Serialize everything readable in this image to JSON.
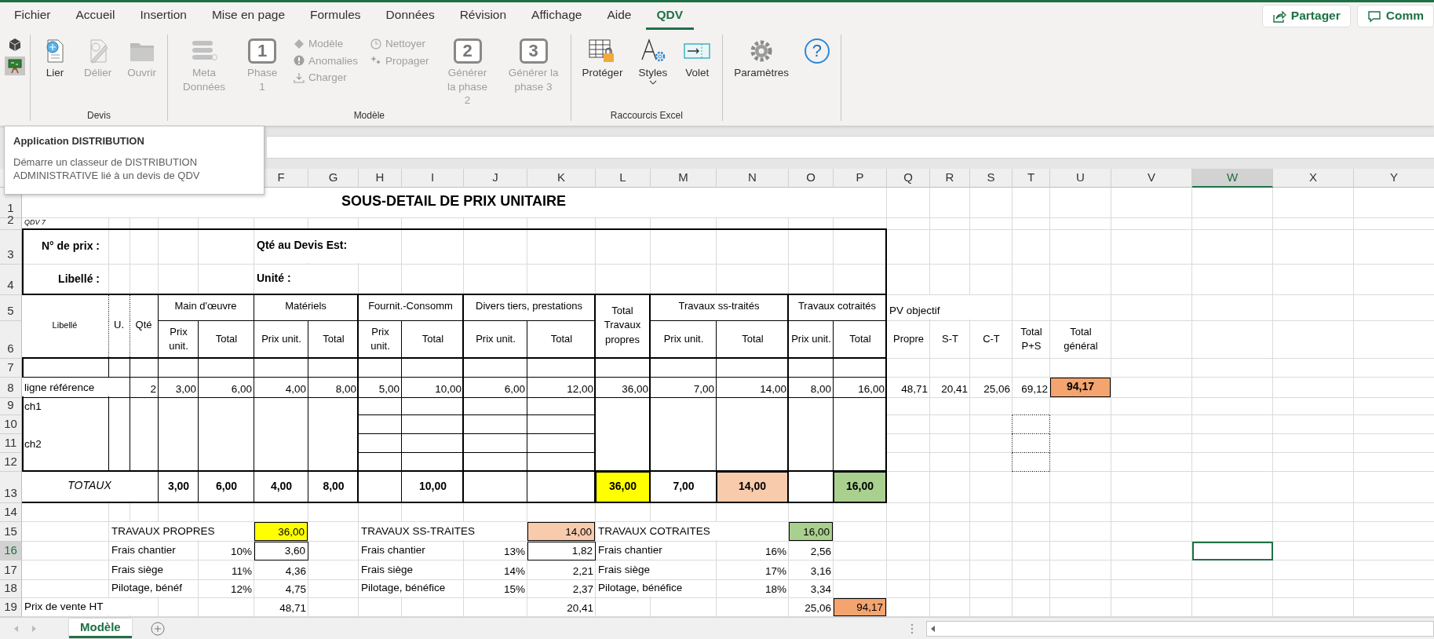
{
  "tabs": [
    {
      "label": "Fichier",
      "selected": false
    },
    {
      "label": "Accueil",
      "selected": false
    },
    {
      "label": "Insertion",
      "selected": false
    },
    {
      "label": "Mise en page",
      "selected": false
    },
    {
      "label": "Formules",
      "selected": false
    },
    {
      "label": "Données",
      "selected": false
    },
    {
      "label": "Révision",
      "selected": false
    },
    {
      "label": "Affichage",
      "selected": false
    },
    {
      "label": "Aide",
      "selected": false
    },
    {
      "label": "QDV",
      "selected": true
    }
  ],
  "header_buttons": [
    {
      "label": "Partager"
    },
    {
      "label": "Comm"
    }
  ],
  "ribbon": {
    "groups": [
      {
        "items": [
          {
            "kind": "tiny",
            "selected": false
          },
          {
            "kind": "tiny",
            "selected": true
          }
        ]
      },
      {
        "label": "Devis",
        "items": [
          {
            "kind": "large",
            "label": "Lier",
            "disabled": false
          },
          {
            "kind": "large",
            "label": "Délier",
            "disabled": true
          },
          {
            "kind": "large",
            "label": "Ouvrir",
            "disabled": true
          }
        ]
      },
      {
        "label": "Modèle",
        "items": [
          {
            "kind": "large",
            "label": "Meta Données",
            "disabled": true
          },
          {
            "kind": "numbered",
            "glyph": "1",
            "label": "Phase 1",
            "disabled": true
          },
          {
            "kind": "small",
            "label": "Modèle",
            "disabled": true
          },
          {
            "kind": "small",
            "label": "Anomalies",
            "disabled": true
          },
          {
            "kind": "small",
            "label": "Charger",
            "disabled": true
          },
          {
            "kind": "small",
            "label": "Nettoyer",
            "disabled": true
          },
          {
            "kind": "small",
            "label": "Propager",
            "disabled": true
          },
          {
            "kind": "numbered",
            "glyph": "2",
            "label": "Générer la phase 2",
            "disabled": true
          },
          {
            "kind": "numbered",
            "glyph": "3",
            "label": "Générer la phase 3",
            "disabled": true
          }
        ]
      },
      {
        "label": "Raccourcis Excel",
        "items": [
          {
            "kind": "large",
            "label": "Protéger",
            "disabled": false
          },
          {
            "kind": "large",
            "label": "Styles",
            "disabled": false,
            "dropdown": true
          },
          {
            "kind": "large",
            "label": "Volet",
            "disabled": false
          }
        ]
      },
      {
        "items": [
          {
            "kind": "large",
            "label": "Paramètres",
            "disabled": false
          },
          {
            "kind": "help",
            "glyph": "?",
            "disabled": false
          }
        ]
      }
    ]
  },
  "tooltip": {
    "title": "Application DISTRIBUTION",
    "text": "Démarre un classeur de DISTRIBUTION ADMINISTRATIVE lié à un devis de QDV"
  },
  "columns": [
    {
      "label": "F",
      "selected": false
    },
    {
      "label": "G",
      "selected": false
    },
    {
      "label": "H",
      "selected": false
    },
    {
      "label": "I",
      "selected": false
    },
    {
      "label": "J",
      "selected": false
    },
    {
      "label": "K",
      "selected": false
    },
    {
      "label": "L",
      "selected": false
    },
    {
      "label": "M",
      "selected": false
    },
    {
      "label": "N",
      "selected": false
    },
    {
      "label": "O",
      "selected": false
    },
    {
      "label": "P",
      "selected": false
    },
    {
      "label": "Q",
      "selected": false
    },
    {
      "label": "R",
      "selected": false
    },
    {
      "label": "S",
      "selected": false
    },
    {
      "label": "T",
      "selected": false
    },
    {
      "label": "U",
      "selected": false
    },
    {
      "label": "V",
      "selected": false
    },
    {
      "label": "W",
      "selected": true
    },
    {
      "label": "X",
      "selected": false
    },
    {
      "label": "Y",
      "selected": false
    }
  ],
  "rows": [
    {
      "label": "1",
      "selected": false,
      "cells": [
        {
          "kind": "title",
          "text": "SOUS-DETAIL DE PRIX UNITAIRE"
        }
      ]
    },
    {
      "label": "2",
      "selected": false,
      "cells": [
        {
          "kind": "note",
          "text": "QDV 7"
        }
      ]
    },
    {
      "label": "3",
      "selected": false,
      "cells": [
        {
          "kind": "field-label",
          "text": "N° de prix :"
        },
        {
          "kind": "label",
          "text": "Qté au Devis Est:"
        }
      ]
    },
    {
      "label": "4",
      "selected": false,
      "cells": [
        {
          "kind": "field-label",
          "text": "Libellé :"
        },
        {
          "kind": "label",
          "text": "Unité :"
        }
      ]
    },
    {
      "label": "5",
      "selected": false,
      "cells": [
        {
          "kind": "head-small",
          "text": "Libellé"
        },
        {
          "kind": "head",
          "text": "U."
        },
        {
          "kind": "head",
          "text": "Qté"
        },
        {
          "kind": "head",
          "text": "Main d'œuvre"
        },
        {
          "kind": "head",
          "text": "Matériels"
        },
        {
          "kind": "head",
          "text": "Fournit.-Consomm"
        },
        {
          "kind": "head",
          "text": "Divers tiers, prestations"
        },
        {
          "kind": "head",
          "text": "Total Travaux propres"
        },
        {
          "kind": "head",
          "text": "Travaux ss-traités"
        },
        {
          "kind": "head",
          "text": "Travaux cotraités"
        },
        {
          "kind": "text",
          "text": "PV objectif"
        }
      ]
    },
    {
      "label": "6",
      "selected": false,
      "cells": [
        {
          "kind": "head",
          "text": "Prix unit."
        },
        {
          "kind": "head",
          "text": "Total"
        },
        {
          "kind": "head",
          "text": "Prix unit."
        },
        {
          "kind": "head",
          "text": "Total"
        },
        {
          "kind": "head",
          "text": "Prix unit."
        },
        {
          "kind": "head",
          "text": "Total"
        },
        {
          "kind": "head",
          "text": "Prix unit."
        },
        {
          "kind": "head",
          "text": "Total"
        },
        {
          "kind": "head",
          "text": "Prix unit."
        },
        {
          "kind": "head",
          "text": "Total"
        },
        {
          "kind": "head",
          "text": "Prix unit."
        },
        {
          "kind": "head",
          "text": "Total"
        },
        {
          "kind": "head",
          "text": "Propre"
        },
        {
          "kind": "head",
          "text": "S-T"
        },
        {
          "kind": "head",
          "text": "C-T"
        },
        {
          "kind": "head",
          "text": "Total P+S"
        },
        {
          "kind": "head",
          "text": "Total général"
        }
      ]
    },
    {
      "label": "7",
      "selected": false
    },
    {
      "label": "8",
      "selected": false,
      "cells": [
        {
          "kind": "text",
          "text": "ligne référence"
        },
        {
          "kind": "num",
          "text": "2"
        },
        {
          "kind": "num",
          "text": "3,00"
        },
        {
          "kind": "num",
          "text": "6,00"
        },
        {
          "kind": "num",
          "text": "4,00"
        },
        {
          "kind": "num",
          "text": "8,00"
        },
        {
          "kind": "num",
          "text": "5,00"
        },
        {
          "kind": "num",
          "text": "10,00"
        },
        {
          "kind": "num",
          "text": "6,00"
        },
        {
          "kind": "num",
          "text": "12,00"
        },
        {
          "kind": "num",
          "text": "36,00"
        },
        {
          "kind": "num",
          "text": "7,00"
        },
        {
          "kind": "num",
          "text": "14,00"
        },
        {
          "kind": "num",
          "text": "8,00"
        },
        {
          "kind": "num",
          "text": "16,00"
        },
        {
          "kind": "num",
          "text": "48,71"
        },
        {
          "kind": "num",
          "text": "20,41"
        },
        {
          "kind": "num",
          "text": "25,06"
        },
        {
          "kind": "num",
          "text": "69,12"
        },
        {
          "kind": "total",
          "text": "94,17",
          "color": "#f4a46f"
        }
      ]
    },
    {
      "label": "9",
      "selected": false,
      "cells": [
        {
          "kind": "text",
          "text": "ch1"
        }
      ]
    },
    {
      "label": "10",
      "selected": false
    },
    {
      "label": "11",
      "selected": false,
      "cells": [
        {
          "kind": "text",
          "text": "ch2"
        }
      ]
    },
    {
      "label": "12",
      "selected": false
    },
    {
      "label": "13",
      "selected": false,
      "cells": [
        {
          "kind": "total-label",
          "text": "TOTAUX"
        },
        {
          "kind": "total",
          "text": "3,00"
        },
        {
          "kind": "total",
          "text": "6,00"
        },
        {
          "kind": "total",
          "text": "4,00"
        },
        {
          "kind": "total",
          "text": "8,00"
        },
        {
          "kind": "total",
          "text": "10,00"
        },
        {
          "kind": "total",
          "text": "36,00",
          "color": "#ffff00"
        },
        {
          "kind": "total",
          "text": "7,00"
        },
        {
          "kind": "total",
          "text": "14,00",
          "color": "#f8cbad"
        },
        {
          "kind": "total",
          "text": "16,00",
          "color": "#a9d08e"
        }
      ]
    },
    {
      "label": "14",
      "selected": false
    },
    {
      "label": "15",
      "selected": false,
      "cells": [
        {
          "kind": "text",
          "text": "TRAVAUX PROPRES"
        },
        {
          "kind": "num",
          "text": "36,00",
          "color": "#ffff00"
        },
        {
          "kind": "text",
          "text": "TRAVAUX SS-TRAITES"
        },
        {
          "kind": "num",
          "text": "14,00",
          "color": "#f8cbad"
        },
        {
          "kind": "text",
          "text": "TRAVAUX COTRAITES"
        },
        {
          "kind": "num",
          "text": "16,00",
          "color": "#a9d08e"
        }
      ]
    },
    {
      "label": "16",
      "selected": true,
      "cells": [
        {
          "kind": "text",
          "text": "Frais chantier"
        },
        {
          "kind": "num",
          "text": "10%"
        },
        {
          "kind": "box",
          "text": "3,60"
        },
        {
          "kind": "text",
          "text": "Frais chantier"
        },
        {
          "kind": "num",
          "text": "13%"
        },
        {
          "kind": "box",
          "text": "1,82"
        },
        {
          "kind": "text",
          "text": "Frais chantier"
        },
        {
          "kind": "num",
          "text": "16%"
        },
        {
          "kind": "num",
          "text": "2,56"
        }
      ]
    },
    {
      "label": "17",
      "selected": false,
      "cells": [
        {
          "kind": "text",
          "text": "Frais siège"
        },
        {
          "kind": "num",
          "text": "11%"
        },
        {
          "kind": "num",
          "text": "4,36"
        },
        {
          "kind": "text",
          "text": "Frais siège"
        },
        {
          "kind": "num",
          "text": "14%"
        },
        {
          "kind": "num",
          "text": "2,21"
        },
        {
          "kind": "text",
          "text": "Frais siège"
        },
        {
          "kind": "num",
          "text": "17%"
        },
        {
          "kind": "num",
          "text": "3,16"
        }
      ]
    },
    {
      "label": "18",
      "selected": false,
      "cells": [
        {
          "kind": "text",
          "text": "Pilotage, bénéf"
        },
        {
          "kind": "num",
          "text": "12%"
        },
        {
          "kind": "num",
          "text": "4,75"
        },
        {
          "kind": "text",
          "text": "Pilotage, bénéfice"
        },
        {
          "kind": "num",
          "text": "15%"
        },
        {
          "kind": "num",
          "text": "2,37"
        },
        {
          "kind": "text",
          "text": "Pilotage, bénéfice"
        },
        {
          "kind": "num",
          "text": "18%"
        },
        {
          "kind": "num",
          "text": "3,34"
        }
      ]
    },
    {
      "label": "19",
      "selected": false,
      "cells": [
        {
          "kind": "text",
          "text": "Prix de vente HT"
        },
        {
          "kind": "num",
          "text": "48,71"
        },
        {
          "kind": "num",
          "text": "20,41"
        },
        {
          "kind": "num",
          "text": "25,06"
        },
        {
          "kind": "num",
          "text": "94,17",
          "color": "#f4a46f"
        }
      ]
    }
  ],
  "sheets": [
    {
      "label": "Modèle",
      "selected": true
    }
  ]
}
